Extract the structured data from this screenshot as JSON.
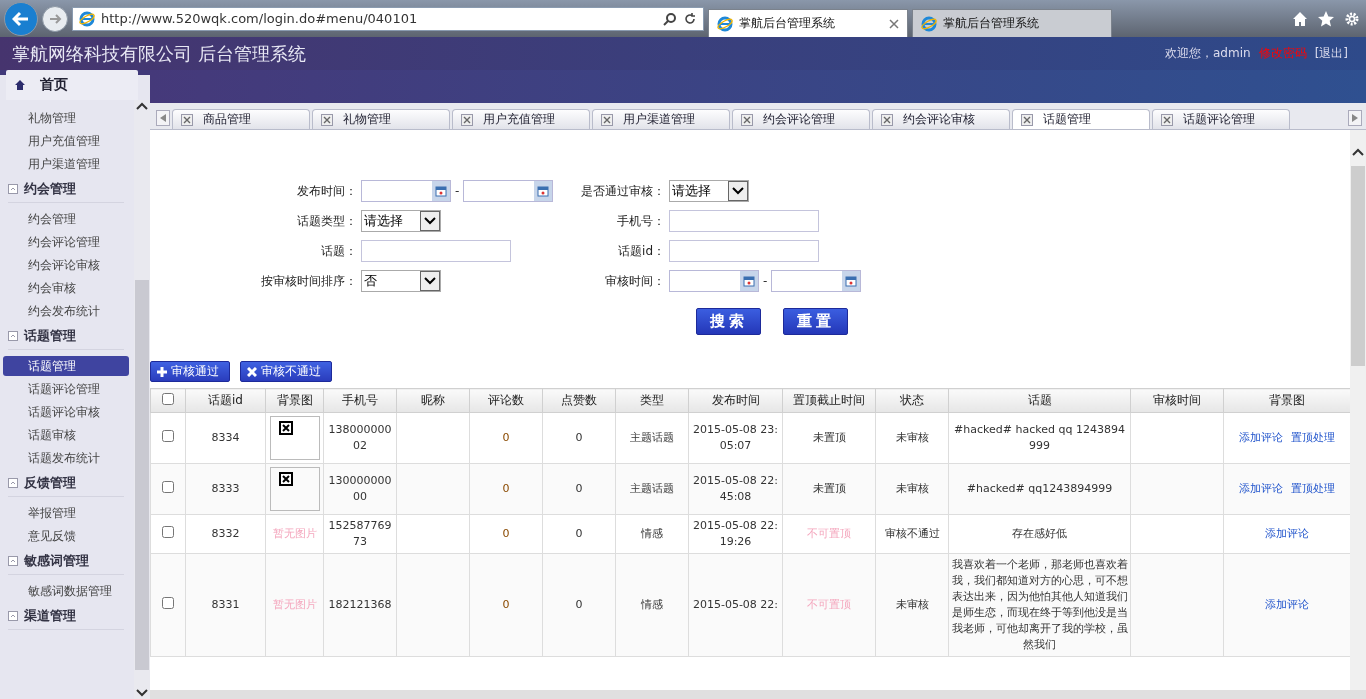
{
  "browser": {
    "address": "http://www.520wqk.com/login.do#menu/040101",
    "tabs": [
      {
        "title": "掌航后台管理系统",
        "selected": true
      },
      {
        "title": "掌航后台管理系统",
        "selected": false
      }
    ]
  },
  "header": {
    "title": "掌航网络科技有限公司 后台管理系统",
    "welcome": "欢迎您，admin",
    "change_password": "修改密码",
    "logout": "[退出]"
  },
  "sidebar": {
    "home": "首页",
    "groups": [
      {
        "items": [
          {
            "label": "礼物管理",
            "selected": false
          },
          {
            "label": "用户充值管理",
            "selected": false
          },
          {
            "label": "用户渠道管理",
            "selected": false
          }
        ]
      },
      {
        "title": "约会管理",
        "items": [
          {
            "label": "约会管理",
            "selected": false
          },
          {
            "label": "约会评论管理",
            "selected": false
          },
          {
            "label": "约会评论审核",
            "selected": false
          },
          {
            "label": "约会审核",
            "selected": false
          },
          {
            "label": "约会发布统计",
            "selected": false
          }
        ]
      },
      {
        "title": "话题管理",
        "items": [
          {
            "label": "话题管理",
            "selected": true
          },
          {
            "label": "话题评论管理",
            "selected": false
          },
          {
            "label": "话题评论审核",
            "selected": false
          },
          {
            "label": "话题审核",
            "selected": false
          },
          {
            "label": "话题发布统计",
            "selected": false
          }
        ]
      },
      {
        "title": "反馈管理",
        "items": [
          {
            "label": "举报管理",
            "selected": false
          },
          {
            "label": "意见反馈",
            "selected": false
          }
        ]
      },
      {
        "title": "敏感词管理",
        "items": [
          {
            "label": "敏感词数据管理",
            "selected": false
          }
        ]
      },
      {
        "title": "渠道管理"
      }
    ]
  },
  "tabs": [
    {
      "label": "商品管理",
      "selected": false
    },
    {
      "label": "礼物管理",
      "selected": false
    },
    {
      "label": "用户充值管理",
      "selected": false
    },
    {
      "label": "用户渠道管理",
      "selected": false
    },
    {
      "label": "约会评论管理",
      "selected": false
    },
    {
      "label": "约会评论审核",
      "selected": false
    },
    {
      "label": "话题管理",
      "selected": true
    },
    {
      "label": "话题评论管理",
      "selected": false
    }
  ],
  "filters": {
    "left": [
      {
        "kind": "date_range",
        "label": "发布时间：",
        "separator": "-"
      },
      {
        "kind": "select",
        "label": "话题类型：",
        "value": "请选择"
      },
      {
        "kind": "text",
        "label": "话题："
      },
      {
        "kind": "select",
        "label": "按审核时间排序：",
        "value": "否"
      }
    ],
    "right": [
      {
        "kind": "select",
        "label": "是否通过审核：",
        "value": "请选择"
      },
      {
        "kind": "text",
        "label": "手机号："
      },
      {
        "kind": "text",
        "label": "话题id："
      },
      {
        "kind": "date_range",
        "label": "审核时间：",
        "separator": "-"
      }
    ],
    "buttons": [
      "搜索",
      "重置"
    ]
  },
  "actions": [
    {
      "kind": "approve",
      "label": "审核通过"
    },
    {
      "kind": "reject",
      "label": "审核不通过"
    }
  ],
  "table": {
    "select_all": {
      "checked": false
    },
    "columns": [
      "话题id",
      "背景图",
      "手机号",
      "昵称",
      "评论数",
      "点赞数",
      "类型",
      "发布时间",
      "置顶截止时间",
      "状态",
      "话题",
      "审核时间",
      "背景图"
    ],
    "rows": [
      {
        "checked": false,
        "id": "8334",
        "image": {
          "kind": "broken"
        },
        "phone": "13800000002",
        "comments": "0",
        "likes": "0",
        "type": "主题话题",
        "published": "2015-05-08 23:05:07",
        "pin": {
          "text": "未置顶",
          "disabled": false
        },
        "status": "未审核",
        "topic": "#hacked# hacked qq 1243894999",
        "actions": [
          "添加评论",
          "置顶处理"
        ]
      },
      {
        "checked": false,
        "id": "8333",
        "image": {
          "kind": "broken"
        },
        "phone": "13000000000",
        "comments": "0",
        "likes": "0",
        "type": "主题话题",
        "published": "2015-05-08 22:45:08",
        "pin": {
          "text": "未置顶",
          "disabled": false
        },
        "status": "未审核",
        "topic": "#hacked# qq1243894999",
        "actions": [
          "添加评论",
          "置顶处理"
        ]
      },
      {
        "checked": false,
        "id": "8332",
        "image": {
          "kind": "none",
          "text": "暂无图片"
        },
        "phone": "15258776973",
        "comments": "0",
        "likes": "0",
        "type": "情感",
        "published": "2015-05-08 22:19:26",
        "pin": {
          "text": "不可置顶",
          "disabled": true
        },
        "status": "审核不通过",
        "topic": "存在感好低",
        "actions": [
          "添加评论"
        ]
      },
      {
        "checked": false,
        "id": "8331",
        "image": {
          "kind": "none",
          "text": "暂无图片"
        },
        "phone": "182121368",
        "comments": "0",
        "likes": "0",
        "type": "情感",
        "published": "2015-05-08 22:",
        "pin": {
          "text": "不可置顶",
          "disabled": true
        },
        "status": "未审核",
        "topic": "我喜欢着一个老师，那老师也喜欢着我，我们都知道对方的心思，可不想表达出来，因为他怕其他人知道我们是师生恋，而现在终于等到他没是当我老师，可他却离开了我的学校，虽然我们",
        "actions": [
          "添加评论"
        ]
      }
    ]
  }
}
